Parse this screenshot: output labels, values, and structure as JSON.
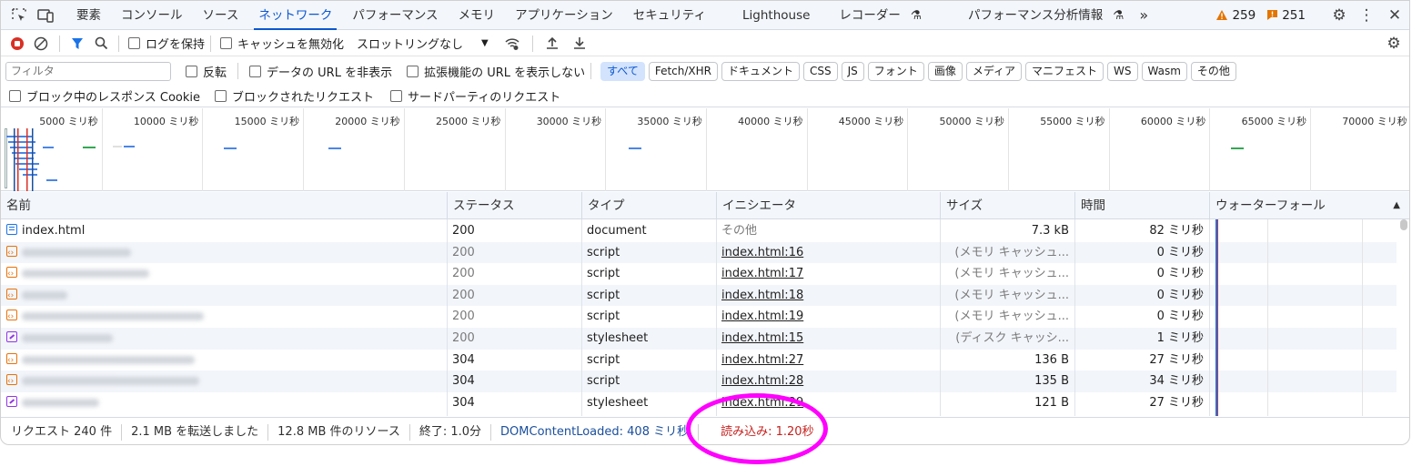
{
  "tabs": {
    "items": [
      "要素",
      "コンソール",
      "ソース",
      "ネットワーク",
      "パフォーマンス",
      "メモリ",
      "アプリケーション",
      "セキュリティ",
      "Lighthouse",
      "レコーダー",
      "パフォーマンス分析情報"
    ],
    "active_index": 3,
    "more": "»",
    "warnings": "259",
    "errors": "251"
  },
  "toolbar": {
    "preserve_log": "ログを保持",
    "disable_cache": "キャッシュを無効化",
    "throttling": "スロットリングなし"
  },
  "filter": {
    "placeholder": "フィルタ",
    "invert": "反転",
    "hide_data_urls": "データの URL を非表示",
    "show_extension_urls": "拡張機能の URL を表示しない",
    "chips": [
      "すべて",
      "Fetch/XHR",
      "ドキュメント",
      "CSS",
      "JS",
      "フォント",
      "画像",
      "メディア",
      "マニフェスト",
      "WS",
      "Wasm",
      "その他"
    ],
    "active_chip": 0
  },
  "blocking": {
    "blocked_response_cookies": "ブロック中のレスポンス Cookie",
    "blocked_requests": "ブロックされたリクエスト",
    "third_party_requests": "サードパーティのリクエスト"
  },
  "overview": {
    "ticks": [
      "5000 ミリ秒",
      "10000 ミリ秒",
      "15000 ミリ秒",
      "20000 ミリ秒",
      "25000 ミリ秒",
      "30000 ミリ秒",
      "35000 ミリ秒",
      "40000 ミリ秒",
      "45000 ミリ秒",
      "50000 ミリ秒",
      "55000 ミリ秒",
      "60000 ミリ秒",
      "65000 ミリ秒",
      "70000 ミリ秒"
    ]
  },
  "table": {
    "headers": [
      "名前",
      "ステータス",
      "タイプ",
      "イニシエータ",
      "サイズ",
      "時間",
      "ウォーターフォール"
    ],
    "rows": [
      {
        "name": "index.html",
        "icon": "document",
        "status": "200",
        "type": "document",
        "initiator": "その他",
        "size": "7.3 kB",
        "time": "82 ミリ秒"
      },
      {
        "name": "",
        "icon": "script",
        "status": "200",
        "type": "script",
        "initiator": "index.html:16",
        "size": "(メモリ キャッシュ...",
        "time": "0 ミリ秒"
      },
      {
        "name": "",
        "icon": "script",
        "status": "200",
        "type": "script",
        "initiator": "index.html:17",
        "size": "(メモリ キャッシュ...",
        "time": "0 ミリ秒"
      },
      {
        "name": "",
        "icon": "script",
        "status": "200",
        "type": "script",
        "initiator": "index.html:18",
        "size": "(メモリ キャッシュ...",
        "time": "0 ミリ秒"
      },
      {
        "name": "",
        "icon": "script",
        "status": "200",
        "type": "script",
        "initiator": "index.html:19",
        "size": "(メモリ キャッシュ...",
        "time": "0 ミリ秒"
      },
      {
        "name": "",
        "icon": "stylesheet",
        "status": "200",
        "type": "stylesheet",
        "initiator": "index.html:15",
        "size": "(ディスク キャッシ...",
        "time": "1 ミリ秒"
      },
      {
        "name": "",
        "icon": "script",
        "status": "304",
        "type": "script",
        "initiator": "index.html:27",
        "size": "136 B",
        "time": "27 ミリ秒"
      },
      {
        "name": "",
        "icon": "script",
        "status": "304",
        "type": "script",
        "initiator": "index.html:28",
        "size": "135 B",
        "time": "34 ミリ秒"
      },
      {
        "name": "",
        "icon": "stylesheet",
        "status": "304",
        "type": "stylesheet",
        "initiator": "index.html:29",
        "size": "121 B",
        "time": "27 ミリ秒"
      }
    ]
  },
  "statusbar": {
    "requests": "リクエスト 240 件",
    "transferred": "2.1 MB を転送しました",
    "resources": "12.8 MB 件のリソース",
    "finish": "終了: 1.0分",
    "dcl": "DOMContentLoaded: 408 ミリ秒",
    "load": "読み込み: 1.20秒"
  },
  "colors": {
    "accent": "#0b57d0",
    "dcl": "#1a4f9c",
    "load": "#c5221f",
    "highlight": "#ff00ff"
  }
}
